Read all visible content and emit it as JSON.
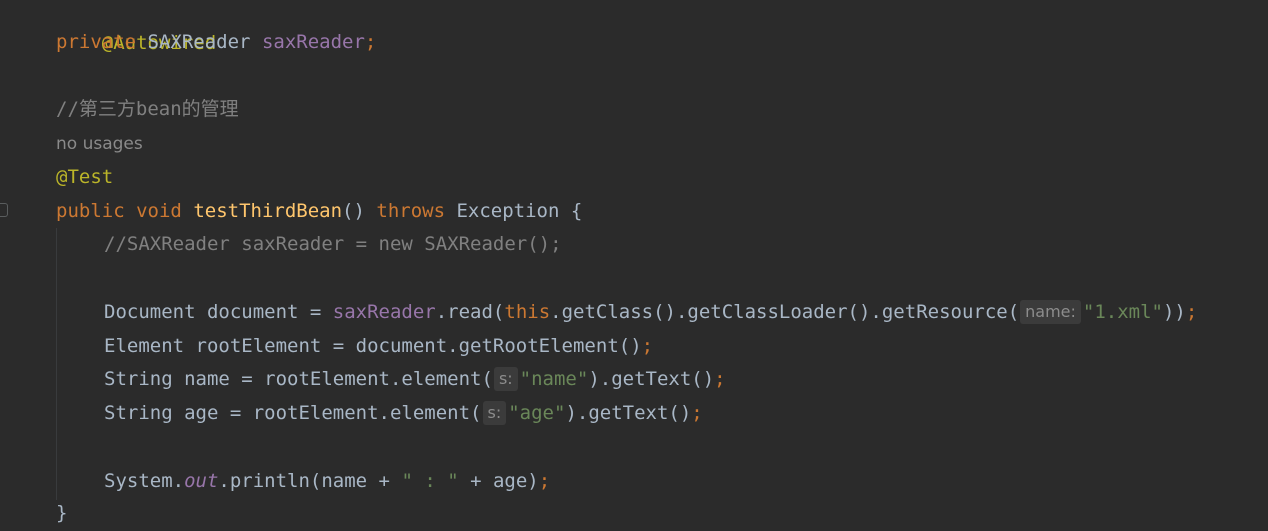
{
  "editor": {
    "lines": {
      "l1": {
        "annotation": "@Autowired"
      },
      "l2": {
        "kw_private": "private",
        "type": "SAXReader",
        "field": "saxReader",
        "semi": ";"
      },
      "l3": {
        "comment": "//第三方bean的管理"
      },
      "l4": {
        "usages": "no usages"
      },
      "l5": {
        "annotation": "@Test"
      },
      "l6": {
        "kw_public": "public",
        "kw_void": "void",
        "method": "testThirdBean",
        "parens": "()",
        "kw_throws": "throws",
        "exception": "Exception {"
      },
      "l7": {
        "comment": "//SAXReader saxReader = new SAXReader();"
      },
      "l8": {
        "pre": "Document document = ",
        "field": "saxReader",
        "mid": ".read(",
        "kw_this": "this",
        "chain": ".getClass().getClassLoader().getResource(",
        "hint": "name:",
        "str": "\"1.xml\"",
        "close": "))",
        "semi": ";"
      },
      "l9": {
        "text": "Element rootElement = document.getRootElement()",
        "semi": ";"
      },
      "l10": {
        "pre": "String name = rootElement.element(",
        "hint": "s:",
        "str": "\"name\"",
        "post": ").getText()",
        "semi": ";"
      },
      "l11": {
        "pre": "String age = rootElement.element(",
        "hint": "s:",
        "str": "\"age\"",
        "post": ").getText()",
        "semi": ";"
      },
      "l12": {
        "pre": "System.",
        "field": "out",
        "mid": ".println(name + ",
        "str": "\" : \"",
        "post": " + age)",
        "semi": ";"
      },
      "l13": {
        "brace": "}"
      }
    }
  },
  "colors": {
    "background": "#2b2b2b",
    "keyword": "#cc7832",
    "annotation": "#bbb529",
    "field": "#9876aa",
    "method": "#ffc66d",
    "string": "#6a8759",
    "comment": "#808080",
    "text": "#a9b7c6"
  }
}
